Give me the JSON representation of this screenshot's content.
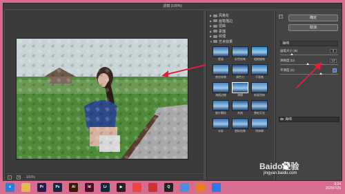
{
  "window": {
    "title": "滤镜 (100%)"
  },
  "status": {
    "zoom_minus": "-",
    "zoom_plus": "+",
    "zoom_value": "100%"
  },
  "gallery": {
    "folders": [
      {
        "label": "风格化",
        "expanded": false
      },
      {
        "label": "画笔描边",
        "expanded": false
      },
      {
        "label": "扭曲",
        "expanded": false
      },
      {
        "label": "素描",
        "expanded": false
      },
      {
        "label": "纹理",
        "expanded": false
      },
      {
        "label": "艺术效果",
        "expanded": true
      }
    ],
    "thumbnails": [
      {
        "label": "壁画",
        "color": "#3b6aa0"
      },
      {
        "label": "彩色铅笔",
        "color": "#2b5c94"
      },
      {
        "label": "粗糙蜡笔",
        "color": "#2a8bc7"
      },
      {
        "label": "底纹效果",
        "color": "#3d7fb8"
      },
      {
        "label": "调色刀",
        "color": "#1e4f8a"
      },
      {
        "label": "干画笔",
        "color": "#2f78b5"
      },
      {
        "label": "海报边缘",
        "color": "#4a85c0"
      },
      {
        "label": "海绵",
        "color": "#2c6aa8"
      },
      {
        "label": "绘画涂抹",
        "color": "#5a8fc4"
      },
      {
        "label": "胶片颗粒",
        "color": "#3b78b0"
      },
      {
        "label": "木刻",
        "color": "#1f5a98"
      },
      {
        "label": "霓虹灯光",
        "color": "#2a4f86"
      },
      {
        "label": "水彩",
        "color": "#3a6aa8"
      },
      {
        "label": "塑料包装",
        "color": "#2c62a0"
      },
      {
        "label": "涂抹棒",
        "color": "#4a80bc"
      }
    ],
    "selected_index": 7
  },
  "panel": {
    "ok": "确定",
    "cancel": "取消",
    "expand": "□",
    "filter_name": "海绵",
    "params": [
      {
        "label": "画笔大小 (B)",
        "value": "2",
        "level": 0.2
      },
      {
        "label": "清晰度 (D)",
        "value": "12",
        "level": 0.48
      },
      {
        "label": "平滑度 (S)",
        "value": "",
        "level": 0.7
      }
    ],
    "layer_label": "海绵"
  },
  "taskbar": {
    "icons": [
      {
        "name": "edge",
        "label": "e",
        "color": "#2d7fd6"
      },
      {
        "name": "folder",
        "label": "",
        "color": "#e7b84a"
      },
      {
        "name": "premiere",
        "label": "Pr",
        "color": "#2a1a4a"
      },
      {
        "name": "photoshop",
        "label": "Ps",
        "color": "#0d2a48"
      },
      {
        "name": "illustrator",
        "label": "Ai",
        "color": "#3a1a06"
      },
      {
        "name": "indesign",
        "label": "Id",
        "color": "#4a0d2a"
      },
      {
        "name": "lightroom",
        "label": "Lr",
        "color": "#0d2a3a"
      },
      {
        "name": "media",
        "label": "▶",
        "color": "#222"
      },
      {
        "name": "gallery",
        "label": "",
        "color": "#e44"
      },
      {
        "name": "game",
        "label": "",
        "color": "#c33"
      },
      {
        "name": "qq",
        "label": "Q",
        "color": "#222"
      },
      {
        "name": "chrome",
        "label": "",
        "color": "#4a90e2"
      },
      {
        "name": "firefox",
        "label": "",
        "color": "#e67e22"
      },
      {
        "name": "app",
        "label": "",
        "color": "#2c7be5"
      }
    ],
    "time": "9:24",
    "date": "2020/7/29"
  },
  "watermark": {
    "text": "Baido经验",
    "url": "jingyan.baidu.com"
  }
}
